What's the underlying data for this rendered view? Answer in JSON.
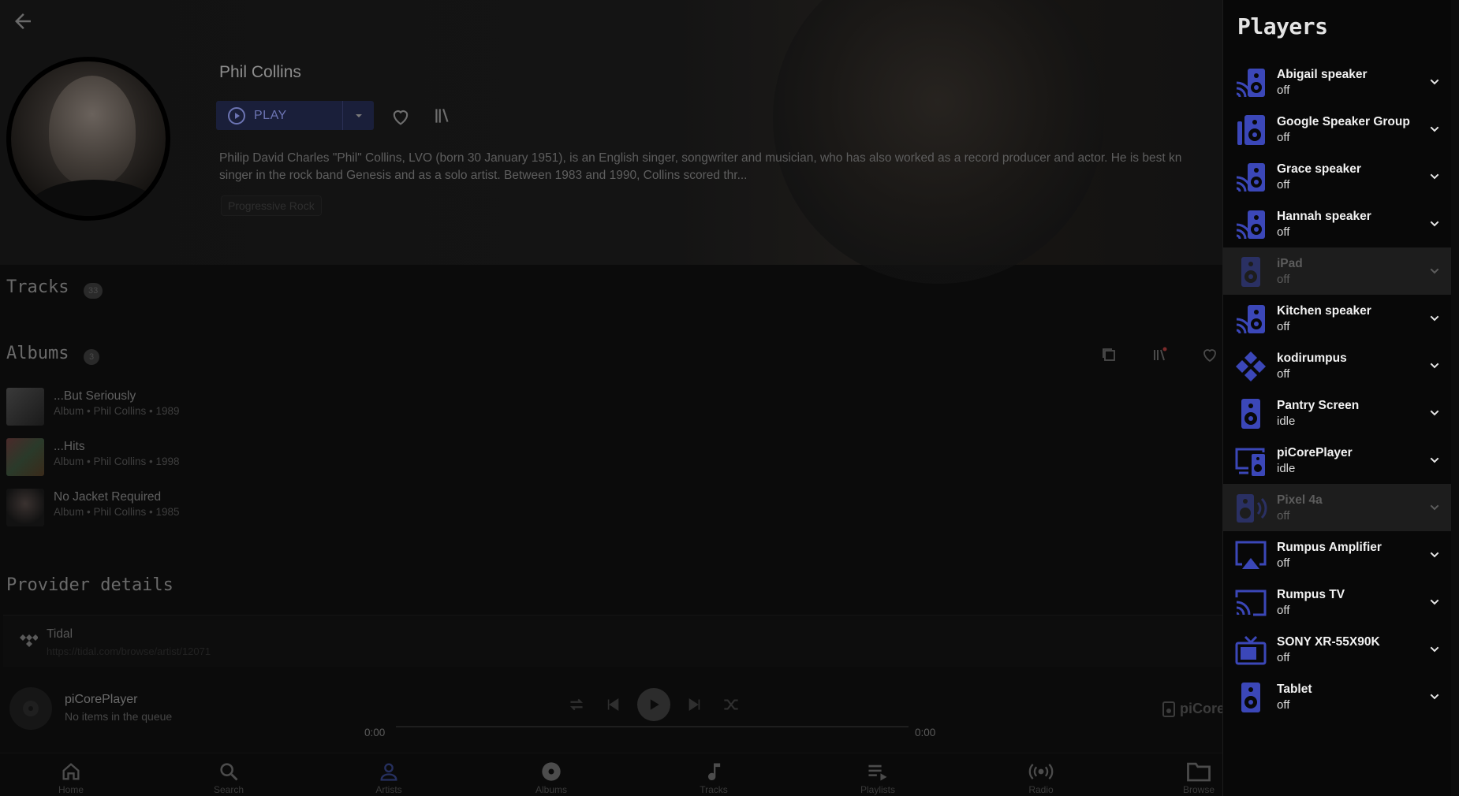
{
  "artist": {
    "name": "Phil Collins",
    "play_label": "PLAY",
    "bio_line1": "Philip David Charles \"Phil\" Collins, LVO (born 30 January 1951), is an English singer, songwriter and musician, who has also worked as a record producer and actor. He is best kn",
    "bio_line2": "singer in the rock band Genesis and as a solo artist. Between 1983 and 1990, Collins scored thr...",
    "genre": "Progressive Rock"
  },
  "sections": {
    "tracks_title": "Tracks",
    "tracks_count": "33",
    "albums_title": "Albums",
    "albums_count": "3",
    "provider_title": "Provider details"
  },
  "albums": [
    {
      "title": "...But Seriously",
      "subtitle": "Album • Phil Collins • 1989"
    },
    {
      "title": "...Hits",
      "subtitle": "Album • Phil Collins • 1998"
    },
    {
      "title": "No Jacket Required",
      "subtitle": "Album • Phil Collins • 1985"
    }
  ],
  "provider": {
    "name": "Tidal",
    "url": "https://tidal.com/browse/artist/12071"
  },
  "now_playing": {
    "player": "piCorePlayer",
    "status": "No items in the queue",
    "time_elapsed": "0:00",
    "time_total": "0:00",
    "player_short": "piCore"
  },
  "nav": [
    {
      "label": "Home",
      "icon": "home-icon"
    },
    {
      "label": "Search",
      "icon": "search-icon"
    },
    {
      "label": "Artists",
      "icon": "person-icon"
    },
    {
      "label": "Albums",
      "icon": "disc-icon"
    },
    {
      "label": "Tracks",
      "icon": "music-note-icon"
    },
    {
      "label": "Playlists",
      "icon": "playlist-icon"
    },
    {
      "label": "Radio",
      "icon": "radio-icon"
    },
    {
      "label": "Browse",
      "icon": "folder-icon"
    }
  ],
  "players_panel": {
    "title": "Players",
    "accent": "#3b47b8",
    "players": [
      {
        "name": "Abigail speaker",
        "state": "off",
        "icon": "cast-speaker-icon"
      },
      {
        "name": "Google Speaker Group",
        "state": "off",
        "icon": "speaker-group-icon"
      },
      {
        "name": "Grace speaker",
        "state": "off",
        "icon": "cast-speaker-icon"
      },
      {
        "name": "Hannah speaker",
        "state": "off",
        "icon": "cast-speaker-icon"
      },
      {
        "name": "iPad",
        "state": "off",
        "icon": "speaker-icon"
      },
      {
        "name": "Kitchen speaker",
        "state": "off",
        "icon": "cast-speaker-icon"
      },
      {
        "name": "kodirumpus",
        "state": "off",
        "icon": "kodi-icon"
      },
      {
        "name": "Pantry Screen",
        "state": "idle",
        "icon": "speaker-icon"
      },
      {
        "name": "piCorePlayer",
        "state": "idle",
        "icon": "monitor-speaker-icon"
      },
      {
        "name": "Pixel 4a",
        "state": "off",
        "icon": "speaker-wireless-icon"
      },
      {
        "name": "Rumpus Amplifier",
        "state": "off",
        "icon": "airplay-icon"
      },
      {
        "name": "Rumpus TV",
        "state": "off",
        "icon": "cast-icon"
      },
      {
        "name": "SONY XR-55X90K",
        "state": "off",
        "icon": "tv-icon"
      },
      {
        "name": "Tablet",
        "state": "off",
        "icon": "speaker-icon"
      }
    ]
  }
}
